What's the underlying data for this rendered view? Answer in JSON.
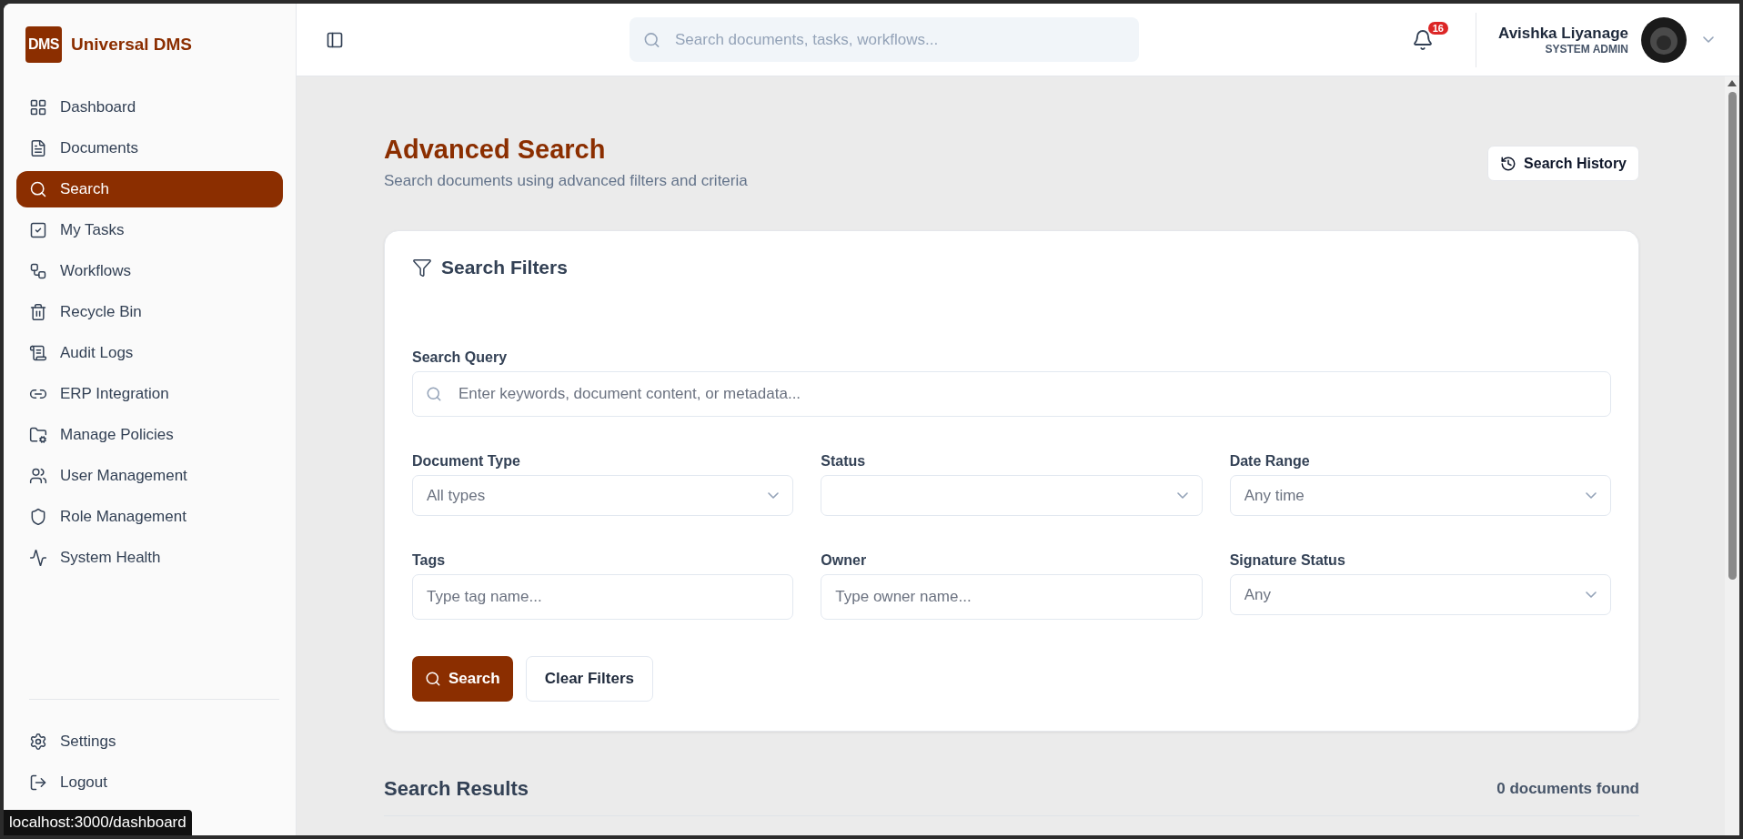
{
  "brand": {
    "logo": "DMS",
    "name": "Universal DMS"
  },
  "sidebar": {
    "items": [
      {
        "label": "Dashboard",
        "selected": false
      },
      {
        "label": "Documents",
        "selected": false
      },
      {
        "label": "Search",
        "selected": true
      },
      {
        "label": "My Tasks",
        "selected": false
      },
      {
        "label": "Workflows",
        "selected": false
      },
      {
        "label": "Recycle Bin",
        "selected": false
      },
      {
        "label": "Audit Logs",
        "selected": false
      },
      {
        "label": "ERP Integration",
        "selected": false
      },
      {
        "label": "Manage Policies",
        "selected": false
      },
      {
        "label": "User Management",
        "selected": false
      },
      {
        "label": "Role Management",
        "selected": false
      },
      {
        "label": "System Health",
        "selected": false
      }
    ],
    "footer_items": [
      {
        "label": "Settings",
        "selected": false
      },
      {
        "label": "Logout",
        "selected": false
      }
    ]
  },
  "header": {
    "search_placeholder": "Search documents, tasks, workflows...",
    "notifications": "16",
    "user": {
      "name": "Avishka Liyanage",
      "role": "SYSTEM ADMIN"
    }
  },
  "page": {
    "title": "Advanced Search",
    "subtitle": "Search documents using advanced filters and criteria",
    "history_button": "Search History"
  },
  "filters": {
    "title": "Search Filters",
    "query": {
      "label": "Search Query",
      "placeholder": "Enter keywords, document content, or metadata..."
    },
    "fields": [
      {
        "label": "Document Type",
        "kind": "select",
        "value": "All types"
      },
      {
        "label": "Status",
        "kind": "select"
      },
      {
        "label": "Date Range",
        "kind": "select",
        "value": "Any time"
      },
      {
        "label": "Tags",
        "kind": "text",
        "placeholder": "Type tag name..."
      },
      {
        "label": "Owner",
        "kind": "text",
        "placeholder": "Type owner name..."
      },
      {
        "label": "Signature Status",
        "kind": "select",
        "value": "Any"
      }
    ],
    "search_button": "Search",
    "clear_button": "Clear Filters"
  },
  "results": {
    "title": "Search Results",
    "count": "0 documents found"
  },
  "status_bar": {
    "url": "localhost:3000/dashboard"
  }
}
